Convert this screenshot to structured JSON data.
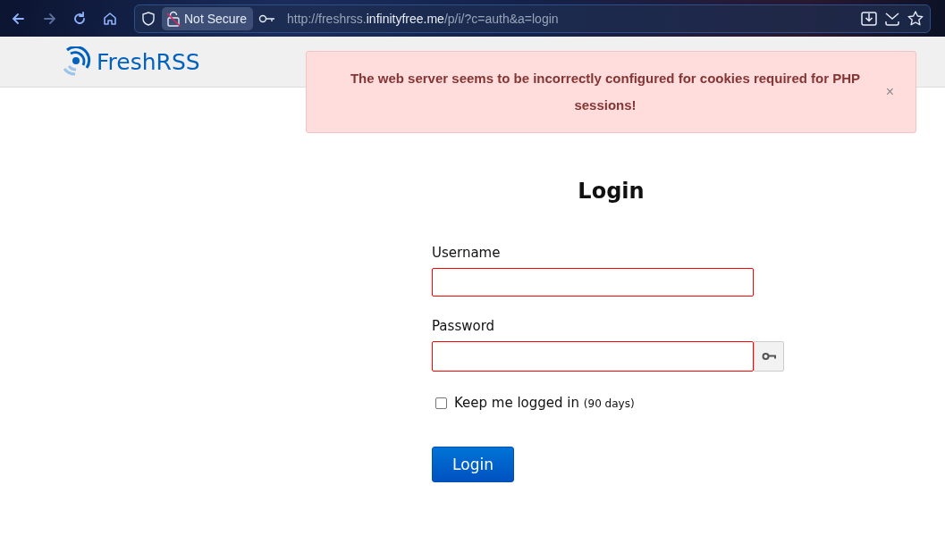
{
  "browser": {
    "nav": [
      {
        "kind": "back",
        "disabled": false
      },
      {
        "kind": "forward",
        "disabled": true
      },
      {
        "kind": "reload",
        "disabled": false
      },
      {
        "kind": "home",
        "disabled": false
      }
    ],
    "security_label": "Not Secure",
    "url": {
      "prefix": "http://freshrss.",
      "host": "infinityfree.me",
      "path": "/p/i/?c=auth&a=login"
    }
  },
  "header": {
    "logo": "FreshRSS"
  },
  "alert": {
    "message": "The web server seems to be incorrectly configured for cookies required for PHP sessions!",
    "close": "×"
  },
  "login": {
    "title": "Login",
    "fields": [
      {
        "label": "Username",
        "kind": "text",
        "invalid": true
      },
      {
        "label": "Password",
        "kind": "password",
        "invalid": true
      }
    ],
    "remember": {
      "label": "Keep me logged in",
      "note": "(90 days)",
      "checked": false
    },
    "submit": "Login"
  }
}
